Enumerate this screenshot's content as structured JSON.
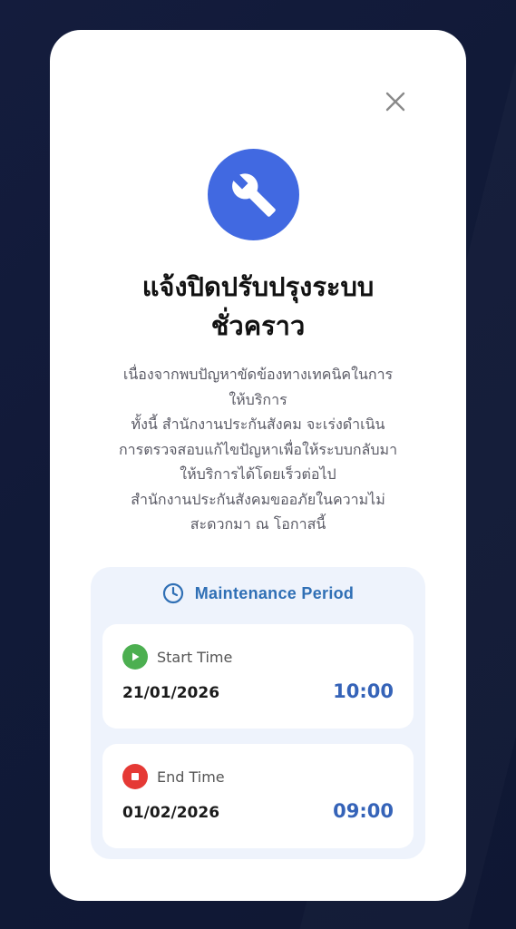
{
  "colors": {
    "background": "#121a38",
    "accent_blue": "#4169e1",
    "period_title": "#2f6fb5",
    "time_value": "#3563b8",
    "start_green": "#4caf50",
    "end_red": "#e53935"
  },
  "modal": {
    "close_icon": "close-icon",
    "hero_icon": "wrench-icon",
    "title_line1": "แจ้งปิดปรับปรุงระบบ",
    "title_line2": "ชั่วคราว",
    "description_lines": [
      "เนื่องจากพบปัญหาขัดข้องทางเทคนิคในการ",
      "ให้บริการ",
      "ทั้งนี้ สำนักงานประกันสังคม จะเร่งดำเนิน",
      "การตรวจสอบแก้ไขปัญหาเพื่อให้ระบบกลับมา",
      "ให้บริการได้โดยเร็วต่อไป",
      "สำนักงานประกันสังคมขออภัยในความไม่",
      "สะดวกมา ณ โอกาสนี้"
    ]
  },
  "maintenance": {
    "title": "Maintenance Period",
    "start": {
      "label": "Start Time",
      "date": "21/01/2026",
      "time": "10:00"
    },
    "end": {
      "label": "End Time",
      "date": "01/02/2026",
      "time": "09:00"
    }
  }
}
